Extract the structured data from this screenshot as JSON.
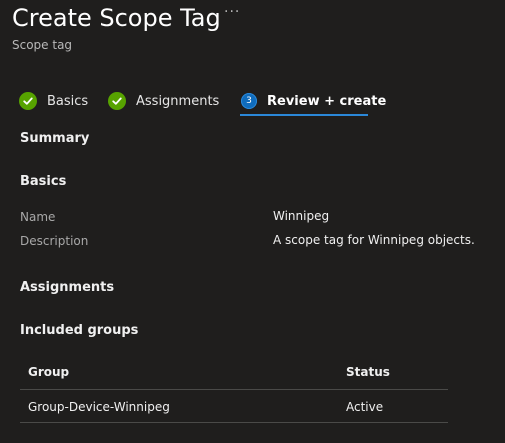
{
  "header": {
    "title": "Create Scope Tag",
    "more_label": "···",
    "subtitle": "Scope tag"
  },
  "tabs": [
    {
      "label": "Basics",
      "state": "complete",
      "icon": "checkmark-icon"
    },
    {
      "label": "Assignments",
      "state": "complete",
      "icon": "checkmark-icon"
    },
    {
      "label": "Review + create",
      "state": "active",
      "step": "3"
    }
  ],
  "colors": {
    "accent": "#2b88d8",
    "success": "#57a300",
    "background": "#1f1e1d"
  },
  "summary": {
    "heading": "Summary",
    "basics": {
      "heading": "Basics",
      "fields": [
        {
          "label": "Name",
          "value": "Winnipeg"
        },
        {
          "label": "Description",
          "value": "A scope tag for Winnipeg objects."
        }
      ]
    },
    "assignments": {
      "heading": "Assignments",
      "included_groups": {
        "heading": "Included groups",
        "columns": [
          "Group",
          "Status"
        ],
        "rows": [
          [
            "Group-Device-Winnipeg",
            "Active"
          ]
        ]
      }
    }
  }
}
